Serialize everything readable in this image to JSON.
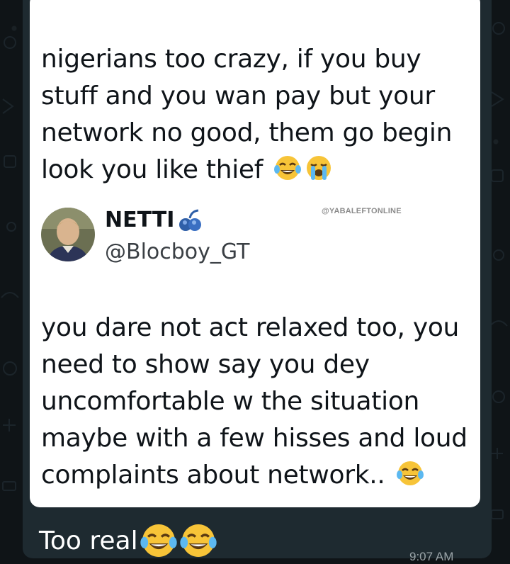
{
  "tweet": {
    "quote_text": "nigerians too crazy, if you buy stuff and you wan pay but your network no good, them go begin look you like thief",
    "quote_emojis": [
      "tears-of-joy-emoji-icon",
      "loudly-crying-emoji-icon"
    ],
    "watermark": "@YABALEFTONLINE",
    "author_name": "NETTI",
    "author_badge_icon": "blue-balls-emoji-icon",
    "author_handle": "@Blocboy_GT",
    "reply_text": "you dare not act relaxed too, you need to show say you dey uncomfortable w the situation maybe with a few hisses and loud complaints about network..",
    "reply_emoji": "tears-of-joy-emoji-icon"
  },
  "message": {
    "caption": "Too real",
    "caption_emojis": [
      "tears-of-joy-emoji-icon",
      "tears-of-joy-emoji-icon"
    ],
    "time": "9:07 AM"
  },
  "colors": {
    "chat_background": "#0f1417",
    "bubble": "#1e2a30",
    "card": "#ffffff",
    "text_dark": "#0f1419",
    "emoji_yellow": "#f7c438",
    "tear_blue": "#5cb8f0"
  }
}
